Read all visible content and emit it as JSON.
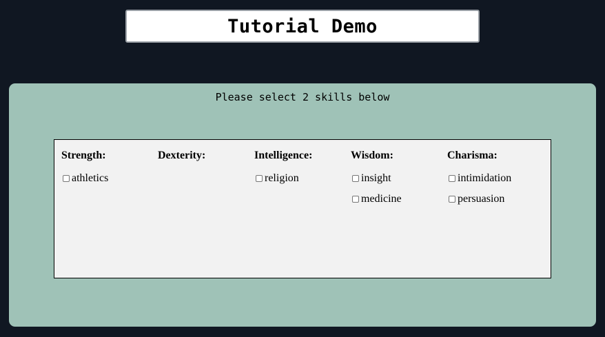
{
  "header": {
    "title": "Tutorial Demo"
  },
  "panel": {
    "instruction": "Please select 2 skills below",
    "columns": [
      {
        "label": "Strength:",
        "skills": [
          "athletics"
        ]
      },
      {
        "label": "Dexterity:",
        "skills": []
      },
      {
        "label": "Intelligence:",
        "skills": [
          "religion"
        ]
      },
      {
        "label": "Wisdom:",
        "skills": [
          "insight",
          "medicine"
        ]
      },
      {
        "label": "Charisma:",
        "skills": [
          "intimidation",
          "persuasion"
        ]
      }
    ]
  },
  "colors": {
    "page_background": "#101722",
    "panel_background": "#9fc2b7",
    "skills_box_background": "#f2f2f2"
  }
}
